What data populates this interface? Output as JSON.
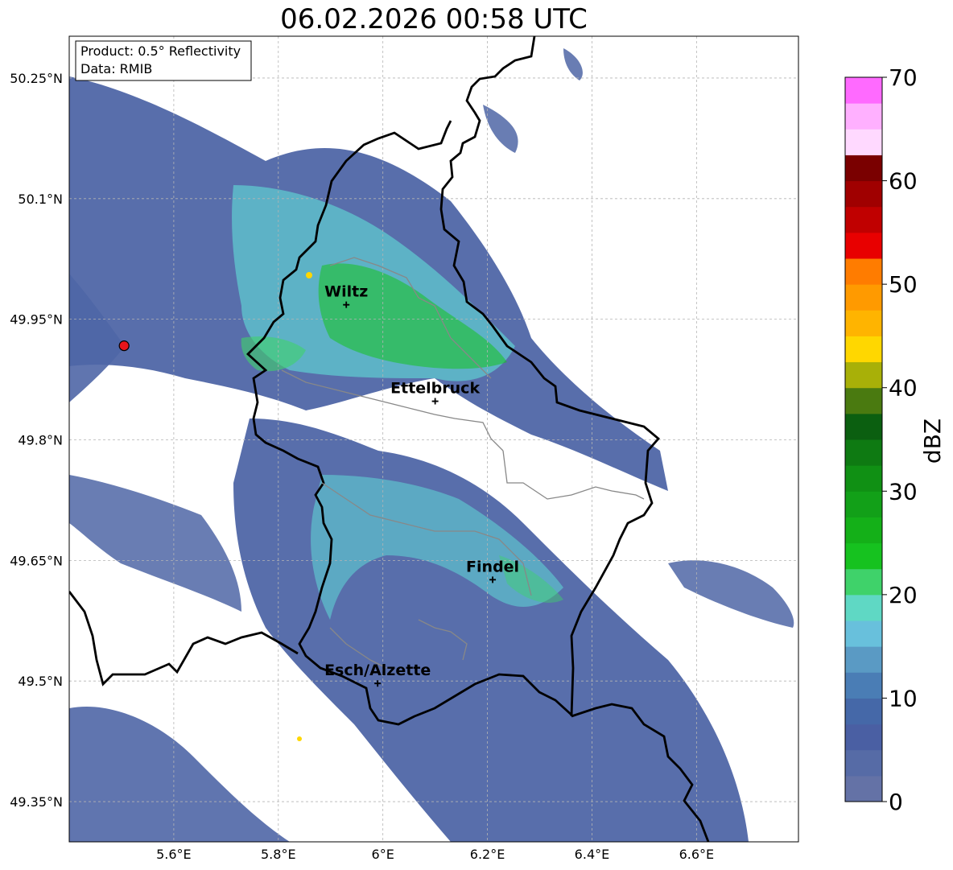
{
  "title": "06.02.2026 00:58 UTC",
  "info_box": {
    "product": "Product: 0.5° Reflectivity",
    "data": "Data: RMIB"
  },
  "lat_ticks": [
    "50.25°N",
    "50.1°N",
    "49.95°N",
    "49.8°N",
    "49.65°N",
    "49.5°N",
    "49.35°N"
  ],
  "lat_values": [
    50.25,
    50.1,
    49.95,
    49.8,
    49.65,
    49.5,
    49.35
  ],
  "lon_ticks": [
    "5.6°E",
    "5.8°E",
    "6°E",
    "6.2°E",
    "6.4°E",
    "6.6°E"
  ],
  "lon_values": [
    5.6,
    5.8,
    6.0,
    6.2,
    6.4,
    6.6
  ],
  "extent": {
    "lon_min": 5.4,
    "lon_max": 6.795,
    "lat_min": 49.3,
    "lat_max": 50.302
  },
  "cities": [
    {
      "name": "Wiltz",
      "lon": 5.93,
      "lat": 49.968
    },
    {
      "name": "Ettelbruck",
      "lon": 6.1,
      "lat": 49.848
    },
    {
      "name": "Findel",
      "lon": 6.21,
      "lat": 49.626
    },
    {
      "name": "Esch/Alzette",
      "lon": 5.99,
      "lat": 49.497
    }
  ],
  "radar_site": {
    "lon": 5.505,
    "lat": 49.917,
    "color": "#e8151b"
  },
  "colorbar": {
    "label": "dBZ",
    "ticks": [
      "0",
      "10",
      "20",
      "30",
      "40",
      "50",
      "60",
      "70"
    ],
    "tick_values": [
      0,
      10,
      20,
      30,
      40,
      50,
      60,
      70
    ],
    "min": 0,
    "max": 70,
    "step": 2.5,
    "colors": [
      "#6472a6",
      "#566ba6",
      "#4a5fa3",
      "#4568a8",
      "#4a7db5",
      "#5a9ac4",
      "#68c0dc",
      "#5fd8c4",
      "#3fd26a",
      "#16c21f",
      "#14b018",
      "#12a018",
      "#109014",
      "#0e7a12",
      "#0b5f10",
      "#4a7a10",
      "#a8b008",
      "#ffd700",
      "#ffb400",
      "#ff9a00",
      "#ff7c00",
      "#e80000",
      "#c00000",
      "#a00000",
      "#7a0000",
      "#ffd9ff",
      "#ffb0ff",
      "#ff6aff",
      "#ea30ea"
    ]
  }
}
